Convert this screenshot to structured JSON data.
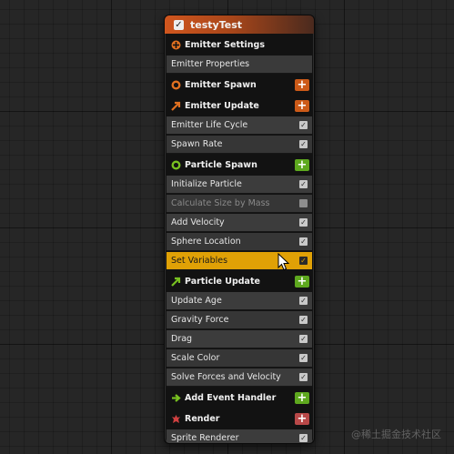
{
  "node": {
    "title": "testyTest",
    "title_checked": true,
    "accent_color": "#d0561e"
  },
  "rows": {
    "emitter_settings": {
      "label": "Emitter Settings",
      "icon": "orange-settings-icon",
      "color": "#e07020"
    },
    "emitter_properties": {
      "label": "Emitter Properties"
    },
    "emitter_spawn": {
      "label": "Emitter Spawn",
      "icon": "orange-ring-icon",
      "color": "#e07020",
      "add_color": "#cc5a18"
    },
    "emitter_update": {
      "label": "Emitter Update",
      "icon": "orange-arrow-icon",
      "color": "#e07020",
      "add_color": "#cc5a18"
    },
    "emitter_life_cycle": {
      "label": "Emitter Life Cycle",
      "checked": true
    },
    "spawn_rate": {
      "label": "Spawn Rate",
      "checked": true
    },
    "particle_spawn": {
      "label": "Particle Spawn",
      "icon": "green-ring-icon",
      "color": "#78c020",
      "add_color": "#5ea81e"
    },
    "initialize_particle": {
      "label": "Initialize Particle",
      "checked": true
    },
    "calculate_size_by_mass": {
      "label": "Calculate Size by Mass",
      "checked": false,
      "disabled": true
    },
    "add_velocity": {
      "label": "Add Velocity",
      "checked": true
    },
    "sphere_location": {
      "label": "Sphere Location",
      "checked": true
    },
    "set_variables": {
      "label": "Set Variables",
      "checked": true,
      "selected": true,
      "selected_color": "#e0a106"
    },
    "particle_update": {
      "label": "Particle Update",
      "icon": "green-arrow-icon",
      "color": "#78c020",
      "add_color": "#5ea81e"
    },
    "update_age": {
      "label": "Update Age",
      "checked": true
    },
    "gravity_force": {
      "label": "Gravity Force",
      "checked": true
    },
    "drag": {
      "label": "Drag",
      "checked": true
    },
    "scale_color": {
      "label": "Scale Color",
      "checked": true
    },
    "solve_forces_and_velocity": {
      "label": "Solve Forces and Velocity",
      "checked": true
    },
    "add_event_handler": {
      "label": "Add Event Handler",
      "icon": "green-arrow-right-icon",
      "color": "#78c020",
      "add_color": "#5ea81e"
    },
    "render": {
      "label": "Render",
      "icon": "red-render-icon",
      "color": "#d04040",
      "add_color": "#b84848"
    },
    "sprite_renderer": {
      "label": "Sprite Renderer",
      "checked": true
    }
  },
  "check_glyph": "✓",
  "plus_glyph": "+",
  "watermark": "@稀土掘金技术社区"
}
